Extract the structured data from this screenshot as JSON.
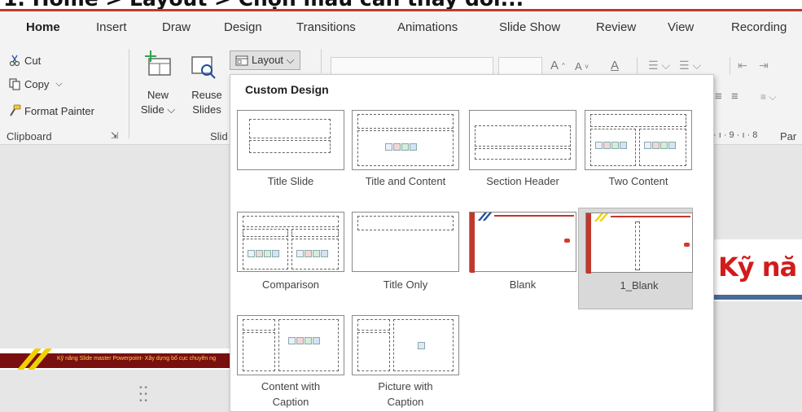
{
  "caption": {
    "text": "1. Home > Layout > Chọn mẫu cần thay đổi..."
  },
  "tabs": [
    {
      "label": "Home",
      "active": true
    },
    {
      "label": "Insert"
    },
    {
      "label": "Draw"
    },
    {
      "label": "Design"
    },
    {
      "label": "Transitions"
    },
    {
      "label": "Animations"
    },
    {
      "label": "Slide Show"
    },
    {
      "label": "Review"
    },
    {
      "label": "View"
    },
    {
      "label": "Recording"
    }
  ],
  "clipboard": {
    "cut": "Cut",
    "copy": "Copy",
    "copy_caret": "⌵",
    "format_painter": "Format Painter",
    "group_label": "Clipboard"
  },
  "slides": {
    "new_slide_line1": "New",
    "new_slide_line2": "Slide ⌵",
    "reuse_line1": "Reuse",
    "reuse_line2": "Slides",
    "layout_button": "Layout ⌵",
    "group_label_partial": "Slid"
  },
  "paragraph": {
    "group_label_partial": "Par"
  },
  "ruler": {
    "text": "· ı · 9 · ı · 8"
  },
  "layout_menu": {
    "title": "Custom Design",
    "layouts": [
      {
        "label": "Title Slide"
      },
      {
        "label": "Title and Content"
      },
      {
        "label": "Section Header"
      },
      {
        "label": "Two Content"
      },
      {
        "label": "Comparison"
      },
      {
        "label": "Title Only"
      },
      {
        "label": "Blank"
      },
      {
        "label": "1_Blank",
        "selected": true
      },
      {
        "label_line1": "Content with",
        "label_line2": "Caption"
      },
      {
        "label_line1": "Picture with",
        "label_line2": "Caption"
      }
    ]
  },
  "slide_preview": {
    "strip_text": "Kỹ năng Slide master Powerpoint- Xây dựng bố cục chuyên ng",
    "big_title": "Kỹ nă"
  },
  "colors": {
    "accent": "#c0392b",
    "ribbon_bg": "#f3f3f3",
    "selected_tile": "#d9d9d9"
  }
}
